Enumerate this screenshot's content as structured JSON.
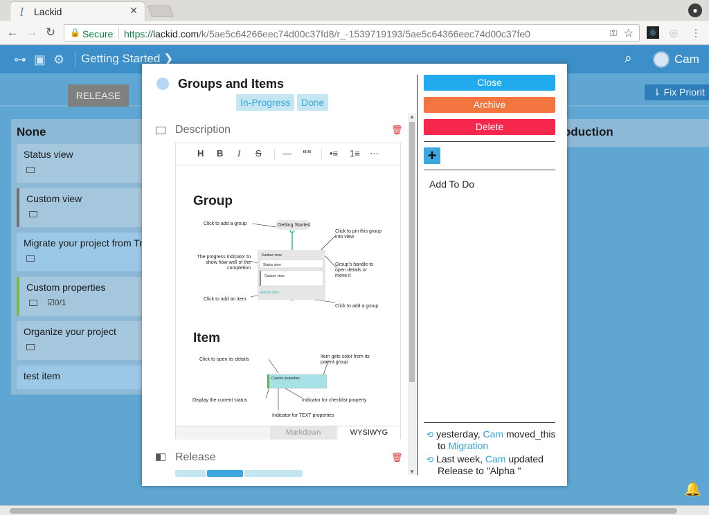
{
  "browser": {
    "tab_title": "Lackid",
    "secure_label": "Secure",
    "url_scheme": "https://",
    "url_host": "lackid.com",
    "url_path": "/k/5ae5c64266eec74d00c37fd8/r_-1539719193/5ae5c64366eec74d00c37fe0"
  },
  "appbar": {
    "title": "Getting Started",
    "user": "Cam"
  },
  "board": {
    "release_tab": "RELEASE",
    "fix_priority_btn": "Fix Priorit",
    "columns": [
      {
        "name": "None",
        "cards": [
          {
            "title": "Status view",
            "checklist": ""
          },
          {
            "title": "Custom view",
            "checklist": ""
          },
          {
            "title": "Migrate your project from Tr",
            "checklist": ""
          },
          {
            "title": "Custom properties",
            "checklist": "0/1"
          },
          {
            "title": "Organize your project",
            "checklist": ""
          },
          {
            "title": "test item",
            "checklist": ""
          }
        ]
      },
      {
        "name": "oduction"
      }
    ]
  },
  "modal": {
    "title": "Groups and Items",
    "statuses": [
      "In-Progress",
      "Done"
    ],
    "description_label": "Description",
    "release_label": "Release",
    "editor": {
      "tools": [
        "H",
        "B",
        "I",
        "S",
        "—",
        "““",
        "•≡",
        "1≡",
        "⋯"
      ],
      "tab_markdown": "Markdown",
      "tab_wysiwyg": "WYSIWYG",
      "group_heading": "Group",
      "item_heading": "Item",
      "group_annotations": {
        "add_group_top": "Click to add a group",
        "getting_started": "Getting Started",
        "pin": "Click to pin this group into view",
        "progress": "The progress indicator to show how well of the completion",
        "kanban": "Kanban view",
        "status_view": "Status view",
        "custom_view": "Custom view",
        "handle": "Group's handle to open details or move it",
        "add_item_link": "Add an item...",
        "add_item": "Click to add an item",
        "add_group_bottom": "Click to add a group"
      },
      "item_annotations": {
        "open": "Click to open its details",
        "color": "Item gets color from its parent group",
        "custom_properties": "Custom properties",
        "status": "Display the current status",
        "checklist": "Indicator for checklist property",
        "text": "Indicator for TEXT properties"
      }
    },
    "buttons": {
      "close": "Close",
      "archive": "Archive",
      "delete": "Delete"
    },
    "add_todo": "Add To Do",
    "activity": [
      {
        "when": "yesterday,",
        "user": "Cam",
        "action": "moved_this",
        "line2_prefix": "to",
        "target": "Migration"
      },
      {
        "when": "Last week,",
        "user": "Cam",
        "action": "updated",
        "line2": "Release to \"Alpha \""
      }
    ],
    "colors": {
      "close": "#22aaee",
      "archive": "#f37540",
      "delete": "#f5274d",
      "chip_bg": "#c3e6f2",
      "chip_text": "#3aa9d8"
    }
  }
}
